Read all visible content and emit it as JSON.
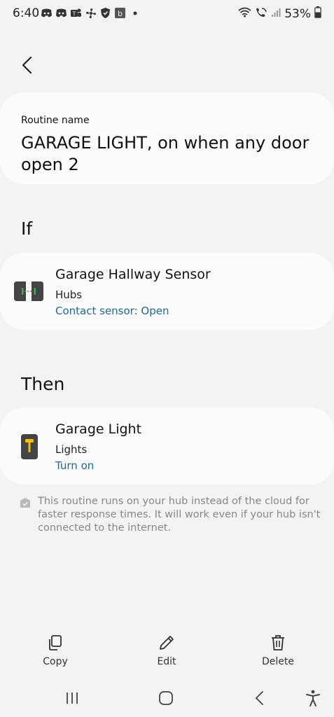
{
  "status_bar": {
    "time": "6:40",
    "battery": "53%",
    "left_icons": [
      "discord-icon",
      "discord-icon",
      "teams-icon",
      "fan-icon",
      "shield-icon",
      "b-app-icon",
      "dot-icon"
    ],
    "right_icons": [
      "wifi-icon",
      "wifi-call-icon",
      "signal-icon",
      "battery-icon"
    ]
  },
  "header": {
    "back_icon": "chevron-left-icon"
  },
  "routine": {
    "label": "Routine name",
    "name": "GARAGE LIGHT, on when any door open 2"
  },
  "if_section": {
    "title": "If",
    "device": {
      "icon": "contact-sensor-icon",
      "name": "Garage Hallway Sensor",
      "room": "Hubs",
      "state": "Contact sensor: Open"
    }
  },
  "then_section": {
    "title": "Then",
    "device": {
      "icon": "light-switch-icon",
      "name": "Garage Light",
      "room": "Lights",
      "state": "Turn on"
    }
  },
  "hub_note": {
    "icon": "hub-check-icon",
    "text": "This routine runs on your hub instead of the cloud for faster response times. It will work even if your hub isn't connected to the internet."
  },
  "actions": {
    "copy": "Copy",
    "edit": "Edit",
    "delete": "Delete"
  },
  "colors": {
    "background": "#f3f3f3",
    "card": "#fbfbfb",
    "link_blue": "#1e6a99",
    "muted_text": "#888888",
    "sensor_green": "#2fb64a",
    "light_yellow": "#f5c000"
  }
}
